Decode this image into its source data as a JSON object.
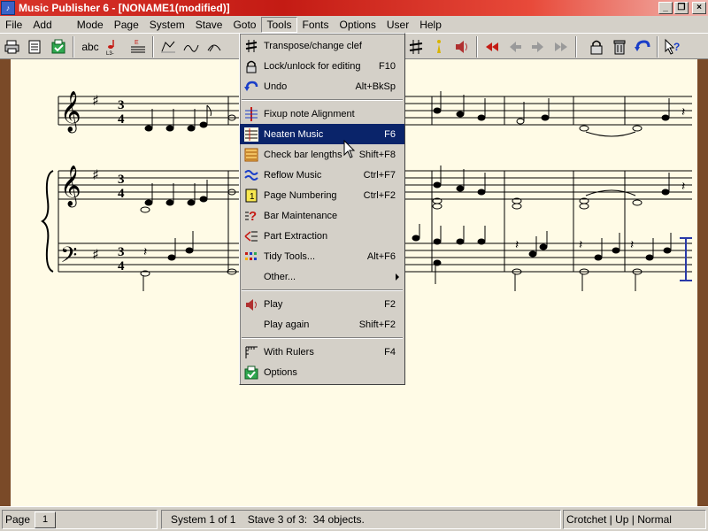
{
  "window": {
    "title": "Music Publisher 6 - [NONAME1(modified)]",
    "app_icon": "music-publisher-icon",
    "buttons": [
      "minimize",
      "restore",
      "close"
    ]
  },
  "menubar": {
    "items": [
      "File",
      "Add",
      "Mode",
      "Page",
      "System",
      "Stave",
      "Goto",
      "Tools",
      "Fonts",
      "Options",
      "User",
      "Help"
    ],
    "active": "Tools"
  },
  "toolbar": {
    "text_button": "abc",
    "item_icons": [
      "print-icon",
      "page-setup-icon",
      "options-icon",
      "text-icon",
      "note-icon",
      "chord-icon",
      "slur-icon",
      "beam-icon",
      "tie-icon",
      "sharp-icon",
      "info-icon",
      "speaker-icon",
      "rewind-icon",
      "back-icon",
      "forward-icon",
      "fast-forward-icon",
      "lock-icon",
      "trash-icon",
      "undo-icon",
      "help-icon"
    ]
  },
  "tools_menu": {
    "items": [
      {
        "label": "Transpose/change clef",
        "shortcut": "",
        "icon": "sharp-icon"
      },
      {
        "label": "Lock/unlock for editing",
        "shortcut": "F10",
        "icon": "lock-icon"
      },
      {
        "label": "Undo",
        "shortcut": "Alt+BkSp",
        "icon": "undo-icon"
      },
      {
        "label": "Fixup note Alignment",
        "shortcut": "",
        "icon": "alignment-icon"
      },
      {
        "label": "Neaten Music",
        "shortcut": "F6",
        "icon": "neaten-icon",
        "highlighted": true
      },
      {
        "label": "Check bar lengths",
        "shortcut": "Shift+F8",
        "icon": "bar-check-icon"
      },
      {
        "label": "Reflow Music",
        "shortcut": "Ctrl+F7",
        "icon": "reflow-icon"
      },
      {
        "label": "Page Numbering",
        "shortcut": "Ctrl+F2",
        "icon": "page-number-icon"
      },
      {
        "label": "Bar Maintenance",
        "shortcut": "",
        "icon": "bar-maintenance-icon"
      },
      {
        "label": "Part Extraction",
        "shortcut": "",
        "icon": "part-extraction-icon"
      },
      {
        "label": "Tidy Tools...",
        "shortcut": "Alt+F6",
        "icon": "tidy-icon"
      },
      {
        "label": "Other...",
        "shortcut": "",
        "icon": "",
        "submenu": true
      },
      {
        "label": "Play",
        "shortcut": "F2",
        "icon": "speaker-icon"
      },
      {
        "label": "Play again",
        "shortcut": "Shift+F2",
        "icon": ""
      },
      {
        "label": "With Rulers",
        "shortcut": "F4",
        "icon": "rulers-icon"
      },
      {
        "label": "Options",
        "shortcut": "",
        "icon": "options-icon"
      }
    ]
  },
  "score": {
    "time_signature": {
      "top": "3",
      "bottom": "4"
    },
    "staves": [
      "treble",
      "treble",
      "bass"
    ]
  },
  "statusbar": {
    "page_label": "Page",
    "page_number": "1",
    "system": "System 1 of 1",
    "stave": "Stave 3 of 3:",
    "objects": "34 objects.",
    "note_info": "Crotchet | Up | Normal"
  },
  "colors": {
    "title_bar": "#d8342b",
    "highlight": "#0a246a",
    "paper": "#fffbe6",
    "desk": "#7a4a28"
  }
}
